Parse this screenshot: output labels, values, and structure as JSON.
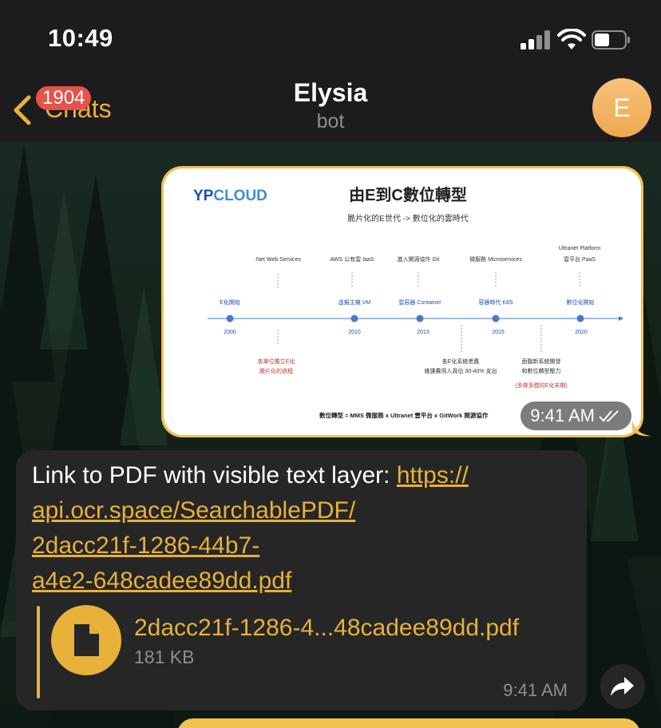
{
  "status_bar": {
    "time": "10:49"
  },
  "nav": {
    "back_label": "Chats",
    "unread_badge": "1904",
    "title": "Elysia",
    "subtitle": "bot",
    "avatar_letter": "E"
  },
  "image_message": {
    "time": "9:41 AM",
    "slide": {
      "logo_prefix": "YP",
      "logo_suffix": "CLOUD",
      "title": "由E到C數位轉型",
      "subtitle": "脆片化的E世代 -> 數位化的雲時代",
      "top_labels": [
        ".Net Web Services",
        "AWS 公有雲 IaaS",
        "進入開源協作 Git",
        "微服務 Microservices",
        "Ultranet Platform",
        "雲平台 PaaS"
      ],
      "point_labels": [
        "E化開始",
        "虛擬主機 VM",
        "雲容器 Container",
        "容器時代 K8S",
        "數位化開始"
      ],
      "years": [
        "2000",
        "2010",
        "2013",
        "2015",
        "2020"
      ],
      "bottom_notes": [
        "各單位獨立E化",
        "脆片化的過程",
        "各E化系統老舊",
        "維護費用人員佔 30-40% 支出",
        "面臨新系統開發",
        "和數位轉型壓力",
        "(多做多錯的E化末期)"
      ],
      "footer": "數位轉型 = MMS 微服務 x Ultranet 雲平台 x GitWork 開源協作"
    }
  },
  "text_message": {
    "prefix": "Link to PDF with visible text layer: ",
    "link_lines": [
      "https://",
      "api.ocr.space/SearchablePDF/",
      "2dacc21f-1286-44b7-",
      "a4e2-648cadee89dd.pdf"
    ],
    "file_name": "2dacc21f-1286-4...48cadee89dd.pdf",
    "file_size": "181 KB",
    "time": "9:41 AM"
  },
  "colors": {
    "accent": "#e7b13a",
    "bubble_out": "#f2c14e",
    "bubble_in": "#262626",
    "badge": "#e5534b"
  },
  "icons": [
    "chevron-left-icon",
    "signal-icon",
    "wifi-icon",
    "battery-icon",
    "double-check-icon",
    "document-icon",
    "share-icon"
  ]
}
